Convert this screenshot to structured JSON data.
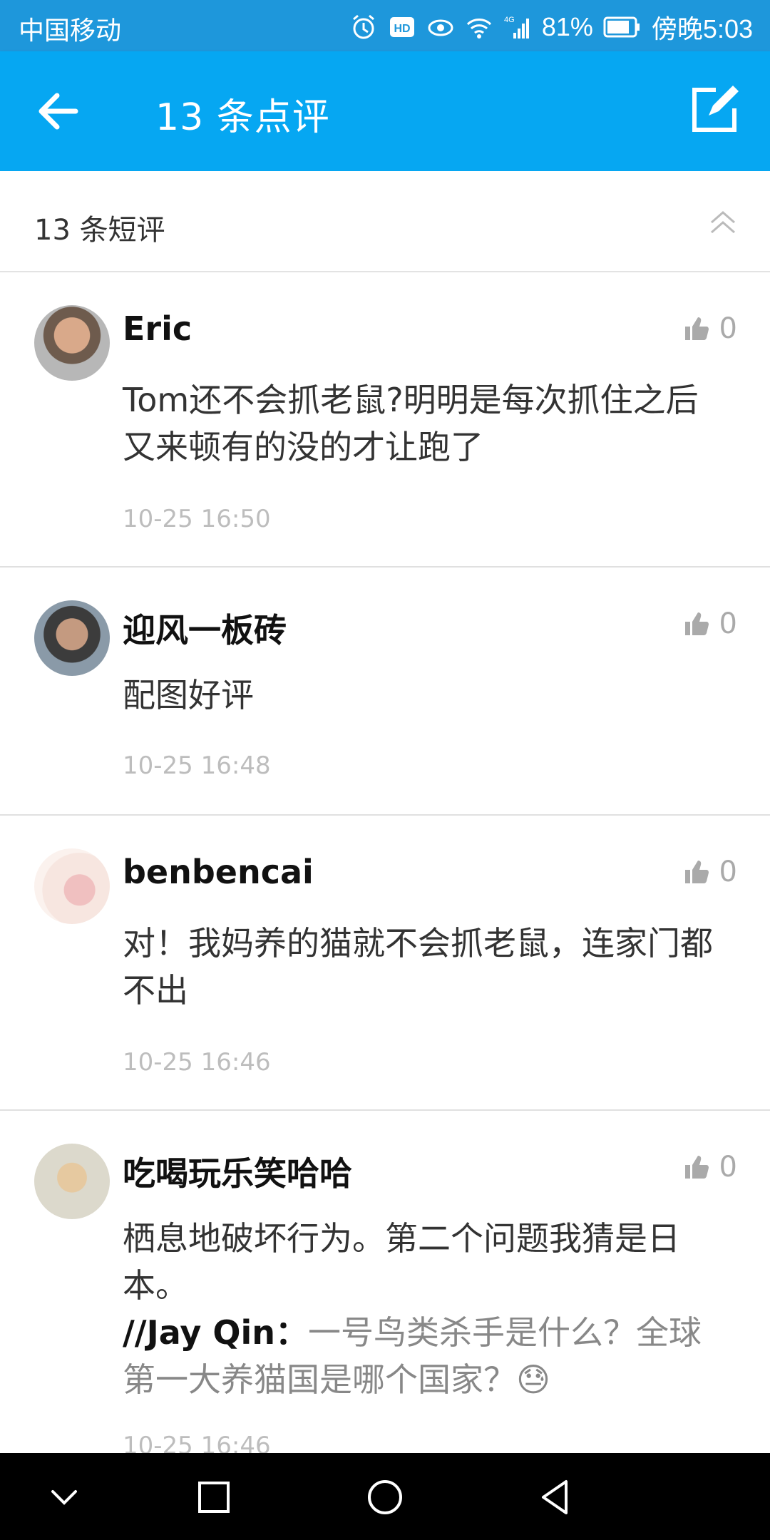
{
  "status_bar": {
    "carrier": "中国移动",
    "network": "4G",
    "battery": "81%",
    "time": "傍晚5:03",
    "icons": [
      "alarm-icon",
      "hd-icon",
      "eye-icon",
      "wifi-icon",
      "signal-icon",
      "battery-icon"
    ]
  },
  "app_bar": {
    "title": "13 条点评",
    "back_icon": "arrow-left-icon",
    "compose_icon": "compose-icon"
  },
  "section": {
    "title": "13 条短评",
    "collapse_icon": "double-chevron-up-icon"
  },
  "comments": [
    {
      "author": "Eric",
      "likes": "0",
      "text": "Tom还不会抓老鼠?明明是每次抓住之后又来顿有的没的才让跑了",
      "time": "10-25 16:50"
    },
    {
      "author": "迎风一板砖",
      "likes": "0",
      "text": "配图好评",
      "time": "10-25 16:48"
    },
    {
      "author": "benbencai",
      "likes": "0",
      "text": "对！我妈养的猫就不会抓老鼠，连家门都不出",
      "time": "10-25 16:46"
    },
    {
      "author": "吃喝玩乐笑哈哈",
      "likes": "0",
      "text": "栖息地破坏行为。第二个问题我猜是日本。",
      "quote_author": "//Jay Qin：",
      "quote_text": "一号鸟类杀手是什么？全球第一大养猫国是哪个国家？😓",
      "time": "10-25 16:46"
    }
  ],
  "nav_bar": {
    "icons": [
      "chevron-down-icon",
      "square-icon",
      "circle-icon",
      "triangle-back-icon"
    ]
  },
  "colors": {
    "status_bar": "#1e97db",
    "app_bar": "#06a7f2",
    "timestamp": "#bdbdbd",
    "like": "#aaaaaa"
  }
}
